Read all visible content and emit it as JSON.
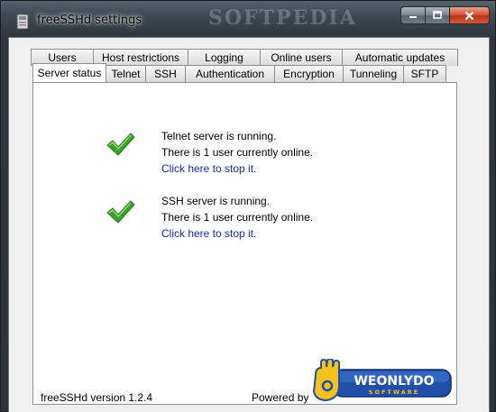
{
  "window": {
    "title": "freeSSHd settings",
    "watermark": "SOFTPEDIA"
  },
  "tabs": {
    "back_row": [
      "Users",
      "Host restrictions",
      "Logging",
      "Online users",
      "Automatic updates"
    ],
    "front_row": [
      "Server status",
      "Telnet",
      "SSH",
      "Authentication",
      "Encryption",
      "Tunneling",
      "SFTP"
    ],
    "selected": "Server status"
  },
  "status": {
    "telnet": {
      "running": "Telnet server is running.",
      "users": "There is 1 user currently online.",
      "action": "Click here to stop it."
    },
    "ssh": {
      "running": "SSH server is running.",
      "users": "There is 1 user currently online.",
      "action": "Click here to stop it."
    }
  },
  "footer": {
    "version": "freeSSHd version 1.2.4",
    "powered_by": "Powered by",
    "logo_top": "WEONLYDO",
    "logo_bottom": "SOFTWARE"
  },
  "icons": {
    "check": "check-icon",
    "close": "close-icon",
    "minimize": "minimize-icon",
    "maximize": "maximize-icon",
    "app": "app-icon"
  },
  "colors": {
    "check_green": "#3aa12a",
    "link_blue": "#1a29a8",
    "close_red": "#c8421f",
    "logo_blue": "#1f4fa8",
    "logo_yellow": "#f4c21a"
  }
}
